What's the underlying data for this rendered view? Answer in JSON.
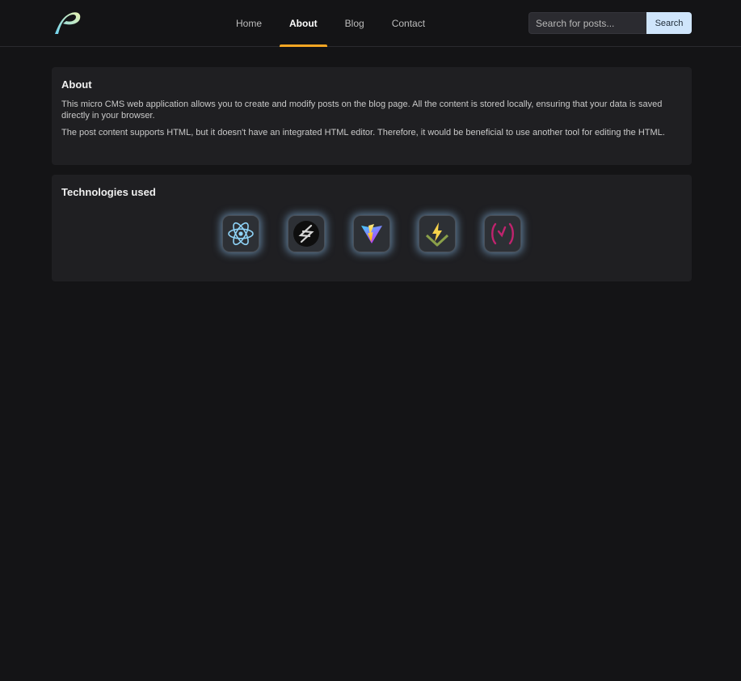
{
  "nav": {
    "links": [
      {
        "label": "Home",
        "active": false
      },
      {
        "label": "About",
        "active": true
      },
      {
        "label": "Blog",
        "active": false
      },
      {
        "label": "Contact",
        "active": false
      }
    ],
    "search": {
      "placeholder": "Search for posts...",
      "button_label": "Search"
    }
  },
  "about": {
    "title": "About",
    "paragraphs": [
      "This micro CMS web application allows you to create and modify posts on the blog page. All the content is stored locally, ensuring that your data is saved directly in your browser.",
      "The post content supports HTML, but it doesn't have an integrated HTML editor. Therefore, it would be beneficial to use another tool for editing the HTML."
    ]
  },
  "technologies": {
    "title": "Technologies used",
    "icons": [
      "react-icon",
      "stylus-icon",
      "vite-icon",
      "vitest-icon",
      "regex-icon"
    ]
  },
  "colors": {
    "background": "#141416",
    "card": "#1f1f22",
    "accent": "#f5a623",
    "search_button": "#cfe5fb",
    "icon_glow": "#96cdff"
  }
}
